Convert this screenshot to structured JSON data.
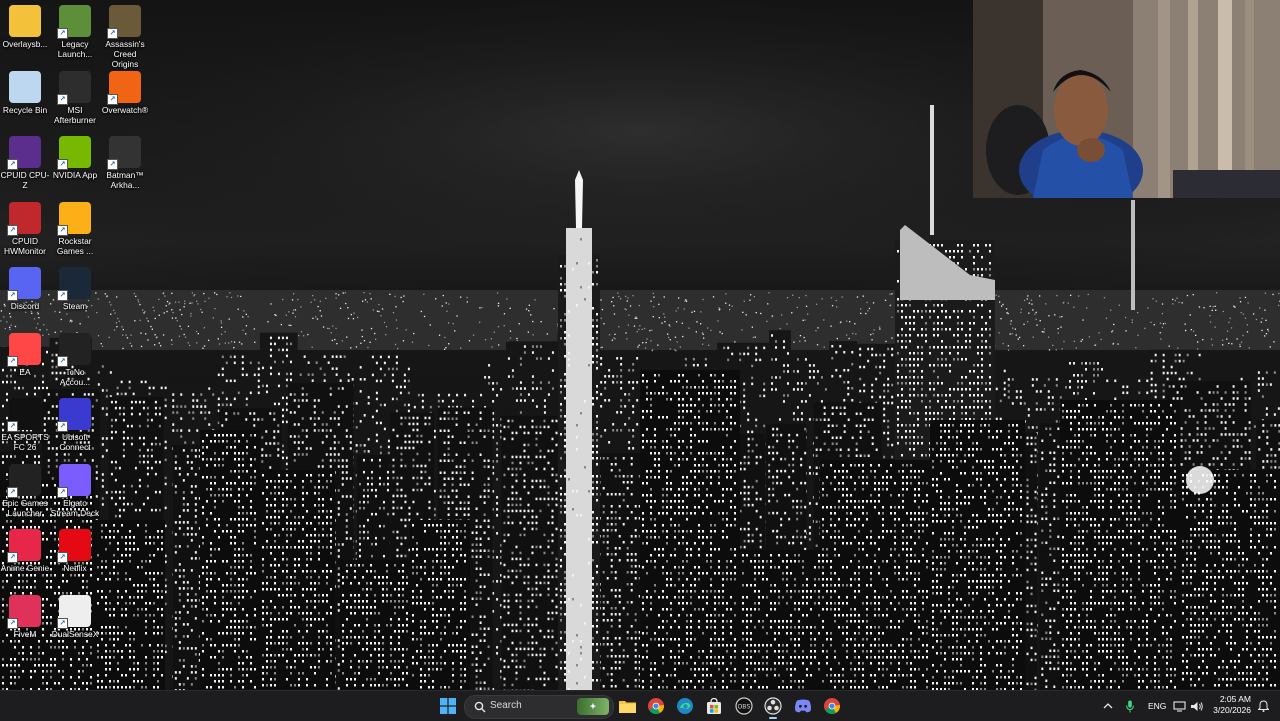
{
  "desktop": {
    "icons": [
      {
        "label": "Overlaysb...",
        "icon": "folder-icon",
        "color": "#f3c13a"
      },
      {
        "label": "Legacy\nLaunch...",
        "icon": "minecraft-icon",
        "color": "#5d8f3a"
      },
      {
        "label": "Assassin's\nCreed Origins",
        "icon": "assassins-creed-icon",
        "color": "#6b5a3a"
      },
      {
        "label": "Recycle Bin",
        "icon": "recycle-bin-icon",
        "color": "#bcd7ef"
      },
      {
        "label": "MSI\nAfterburner",
        "icon": "msi-afterburner-icon",
        "color": "#2d2d2d"
      },
      {
        "label": "Overwatch®",
        "icon": "overwatch-icon",
        "color": "#f06414"
      },
      {
        "label": "CPUID CPU-Z",
        "icon": "cpu-z-icon",
        "color": "#5b2d8c"
      },
      {
        "label": "NVIDIA App",
        "icon": "nvidia-icon",
        "color": "#76b900"
      },
      {
        "label": "Batman™\nArkha...",
        "icon": "batman-icon",
        "color": "#333333"
      },
      {
        "label": "CPUID\nHWMonitor",
        "icon": "hwmonitor-icon",
        "color": "#c0282d"
      },
      {
        "label": "Rockstar\nGames ...",
        "icon": "rockstar-icon",
        "color": "#fcaf17"
      },
      {
        "label": "Discord",
        "icon": "discord-icon",
        "color": "#5865f2"
      },
      {
        "label": "Steam",
        "icon": "steam-icon",
        "color": "#1b2838"
      },
      {
        "label": "EA",
        "icon": "ea-icon",
        "color": "#ff4747"
      },
      {
        "label": "TcNo\nAccou...",
        "icon": "tcno-icon",
        "color": "#222222"
      },
      {
        "label": "EA SPORTS\nFC 26",
        "icon": "ea-sports-fc-icon",
        "color": "#111111"
      },
      {
        "label": "Ubisoft\nConnect",
        "icon": "ubisoft-icon",
        "color": "#3a3ad0"
      },
      {
        "label": "Epic Games\nLauncher",
        "icon": "epic-games-icon",
        "color": "#222222"
      },
      {
        "label": "Elgato\nStream Deck",
        "icon": "stream-deck-icon",
        "color": "#7a5cff"
      },
      {
        "label": "Anime Genie",
        "icon": "anime-genie-icon",
        "color": "#e8264a"
      },
      {
        "label": "Netflix",
        "icon": "netflix-icon",
        "color": "#e50914"
      },
      {
        "label": "FiveM",
        "icon": "fivem-icon",
        "color": "#e0315a"
      },
      {
        "label": "DualSenseX",
        "icon": "dualsensex-icon",
        "color": "#eeeeee"
      }
    ]
  },
  "taskbar": {
    "search_placeholder": "Search",
    "apps": [
      {
        "name": "start",
        "icon": "windows-start-icon"
      },
      {
        "name": "file-explorer",
        "icon": "folder-icon"
      },
      {
        "name": "chrome",
        "icon": "chrome-icon"
      },
      {
        "name": "edge",
        "icon": "edge-icon"
      },
      {
        "name": "store",
        "icon": "store-icon"
      },
      {
        "name": "epix",
        "icon": "app-icon"
      },
      {
        "name": "obs",
        "icon": "obs-icon"
      },
      {
        "name": "discord",
        "icon": "discord-icon"
      },
      {
        "name": "chrome-2",
        "icon": "chrome-icon"
      }
    ],
    "tray": {
      "language": "ENG",
      "time": "2:05 AM",
      "date": "3/20/2026"
    }
  }
}
